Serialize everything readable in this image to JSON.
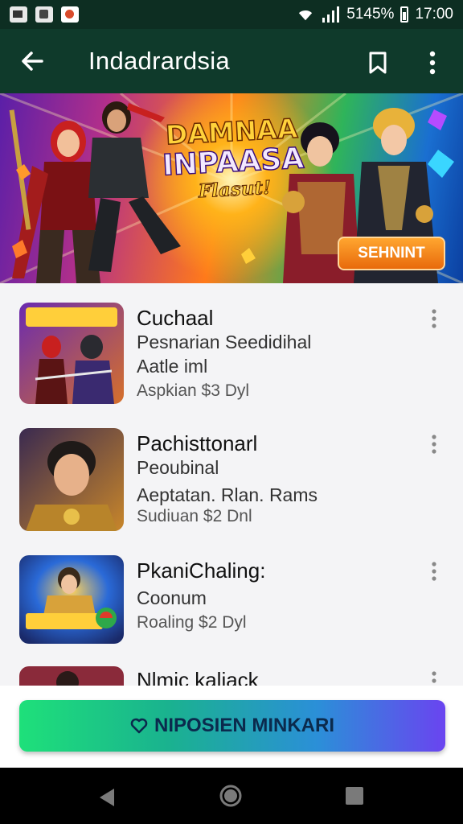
{
  "status_bar": {
    "battery_percent": "5145%",
    "time": "17:00",
    "notification_icons": [
      "photo-icon",
      "gallery-icon",
      "app-icon"
    ]
  },
  "app_bar": {
    "title": "Indadrardsia",
    "icons": [
      "back-arrow-icon",
      "bookmark-icon",
      "more-vert-icon"
    ]
  },
  "banner": {
    "title_line1": "DAMNAA",
    "title_line2": "INPAASA",
    "title_line3": "Flasut!",
    "button_label": "SEHNINT",
    "button_color": "#f08a1f"
  },
  "list": {
    "items": [
      {
        "title": "Cuchaal",
        "line1": "Pesnarian Seedidihal",
        "line2": "Aatle iml",
        "meta": "Aspkian $3 Dyl"
      },
      {
        "title": "Pachisttonarl",
        "line1": "Peoubinal",
        "line2": "Aeptatan. Rlan. Rams",
        "meta": "Sudiuan $2 Dnl"
      },
      {
        "title": "PkaniChaling:",
        "line1": "Coonum",
        "line2": "",
        "meta": "Roaling $2 Dyl"
      },
      {
        "title": "Nlmic kaliack",
        "line1": "",
        "line2": "",
        "meta": ""
      }
    ]
  },
  "footer": {
    "cta_label": "NIPOSIEN MINKARI",
    "cta_icon": "shield-heart-icon"
  },
  "colors": {
    "app_bar": "#0f3a2b",
    "status_bar": "#0d2e22",
    "cta_gradient_start": "#1ee07a",
    "cta_gradient_end": "#6a44f0"
  }
}
